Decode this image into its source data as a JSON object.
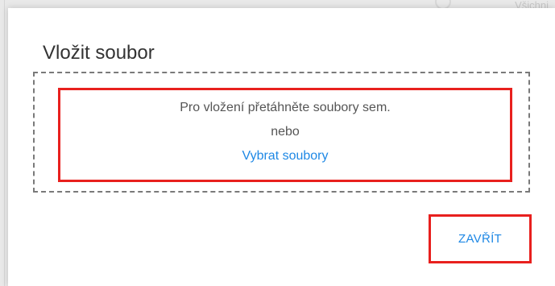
{
  "background": {
    "top_right_text": "Všichni"
  },
  "dialog": {
    "title": "Vložit soubor",
    "dropzone": {
      "instruction": "Pro vložení přetáhněte soubory sem.",
      "separator": "nebo",
      "select_link": "Vybrat soubory"
    },
    "close_label": "ZAVŘÍT"
  },
  "colors": {
    "accent": "#1e88e5",
    "highlight": "#e8201e",
    "dash_border": "#7a7a7a"
  }
}
